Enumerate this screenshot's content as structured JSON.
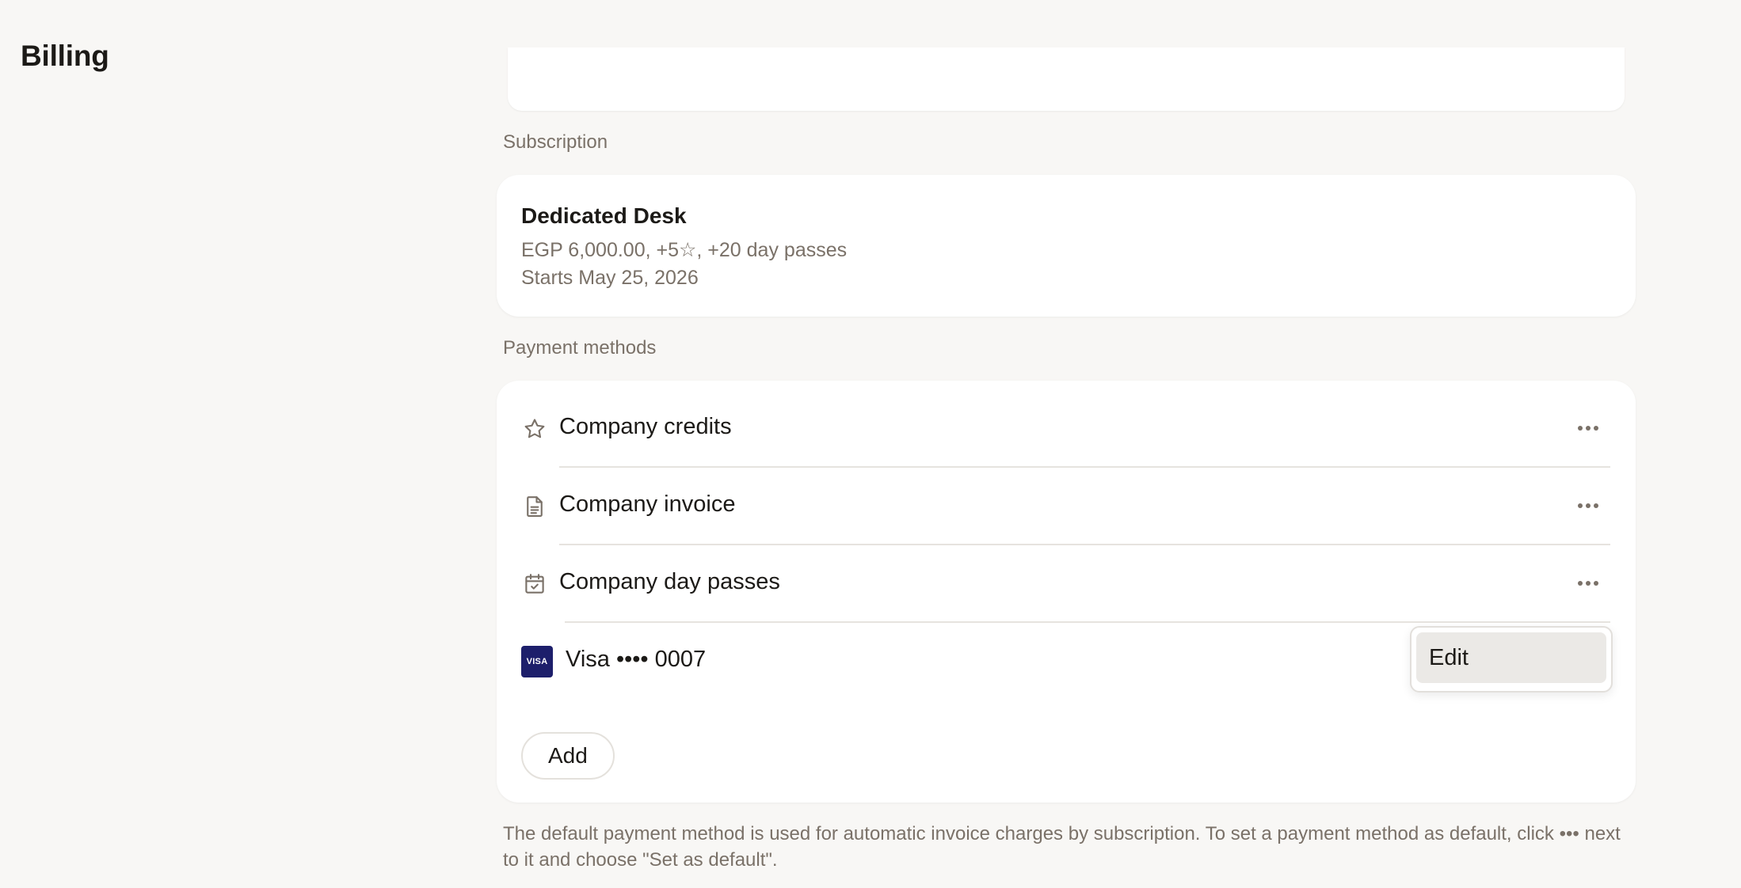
{
  "page": {
    "title": "Billing"
  },
  "subscription": {
    "section_label": "Subscription",
    "plan_name": "Dedicated Desk",
    "details": "EGP 6,000.00, +5☆, +20 day passes",
    "start": "Starts May 25, 2026"
  },
  "payment_methods": {
    "section_label": "Payment methods",
    "items": [
      {
        "label": "Company credits",
        "icon": "star-icon"
      },
      {
        "label": "Company invoice",
        "icon": "document-icon"
      },
      {
        "label": "Company day passes",
        "icon": "calendar-check-icon"
      },
      {
        "label": "Visa •••• 0007",
        "icon": "visa-card-icon",
        "badge_text": "VISA"
      }
    ],
    "add_label": "Add"
  },
  "dropdown": {
    "edit_label": "Edit"
  },
  "footnote": "The default payment method is used for automatic invoice charges by subscription. To set a payment method as default, click ••• next to it and choose \"Set as default\".",
  "colors": {
    "visa": "#1d1f6b",
    "muted_text": "#7a7168",
    "background": "#f8f7f5"
  }
}
